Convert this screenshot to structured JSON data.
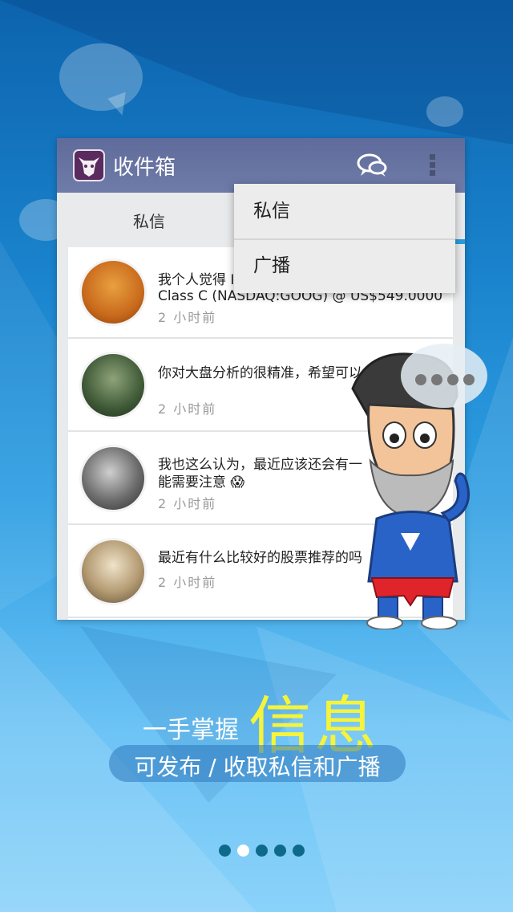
{
  "background": {
    "accent": "#1a83cd"
  },
  "app": {
    "title": "收件箱",
    "icon": "bull-logo-icon"
  },
  "actionbar": {
    "chat_icon": "chat-bubbles-icon",
    "overflow_icon": "overflow-menu-icon"
  },
  "tabs": [
    {
      "label": "私信"
    }
  ],
  "menu": {
    "items": [
      {
        "label": "私信"
      },
      {
        "label": "广播"
      }
    ]
  },
  "messages": [
    {
      "text_line1": "我个人觉得 I",
      "text_line2": "Class C (NASDAQ:GOOG) @ US$549.0000",
      "time": "2 小时前"
    },
    {
      "text_line1": "你对大盘分析的很精准，希望可以多多交流",
      "text_line2": "",
      "time": "2 小时前"
    },
    {
      "text_line1": "我也这么认为，最近应该还会有一",
      "text_line2": "能需要注意 😱",
      "time": "2 小时前"
    },
    {
      "text_line1": "最近有什么比较好的股票推荐的吗",
      "text_line2": "",
      "time": "2 小时前"
    }
  ],
  "slogan": {
    "prefix": "一手掌握",
    "highlight": "信息",
    "subtitle": "可发布 / 收取私信和广播"
  },
  "pager": {
    "count": 5,
    "active": 2
  }
}
